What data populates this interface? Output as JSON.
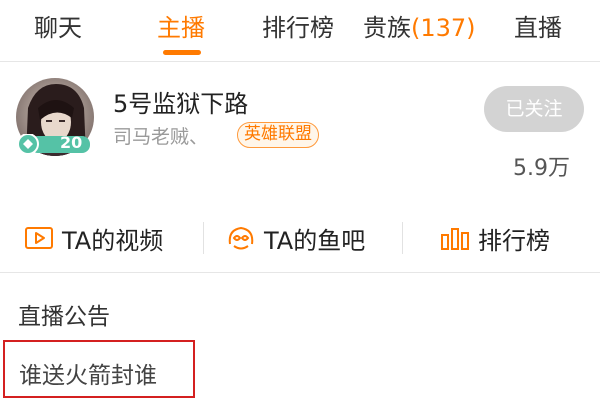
{
  "tabs": [
    {
      "label": "聊天"
    },
    {
      "label": "主播",
      "active": true
    },
    {
      "label": "排行榜"
    },
    {
      "label": "贵族",
      "count": "(137)"
    },
    {
      "label": "直播"
    }
  ],
  "streamer": {
    "name": "5号监狱下路",
    "subtitle": "司马老贼、",
    "category": "英雄联盟",
    "level": "20",
    "follow_label": "已关注",
    "followers": "5.9万"
  },
  "actions": [
    {
      "label": "TA的视频",
      "icon": "video-icon"
    },
    {
      "label": "TA的鱼吧",
      "icon": "fish-bar-icon"
    },
    {
      "label": "排行榜",
      "icon": "ranking-icon"
    }
  ],
  "announcement": {
    "title": "直播公告",
    "text": "谁送火箭封谁"
  },
  "colors": {
    "accent": "#ff7a00",
    "highlight_border": "#d42020",
    "level_badge": "#55c2a6"
  }
}
